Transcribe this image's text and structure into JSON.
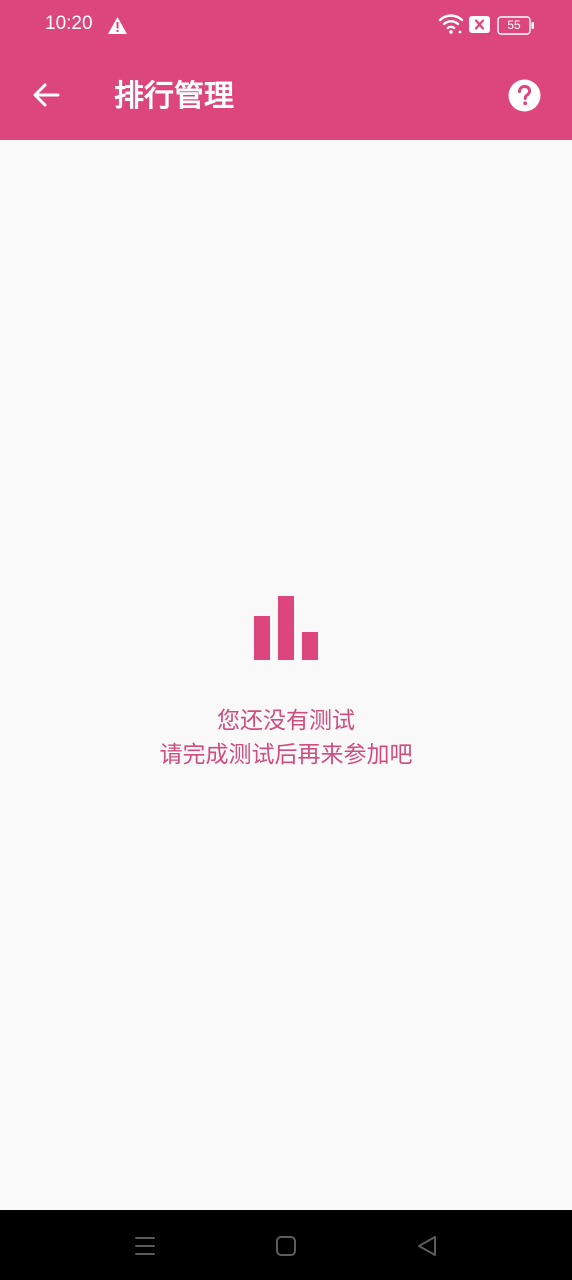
{
  "status_bar": {
    "time": "10:20",
    "battery": "55"
  },
  "header": {
    "title": "排行管理"
  },
  "empty_state": {
    "line1": "您还没有测试",
    "line2": "请完成测试后再来参加吧"
  },
  "colors": {
    "primary": "#dd467d",
    "accent_text": "#d04d7f",
    "background": "#f9f9fa",
    "nav_bar": "#000000"
  },
  "icons": {
    "back": "arrow-left-icon",
    "help": "help-circle-icon",
    "empty": "bar-chart-icon",
    "warning": "warning-icon",
    "wifi": "wifi-icon",
    "sim": "sim-icon",
    "battery": "battery-icon"
  }
}
